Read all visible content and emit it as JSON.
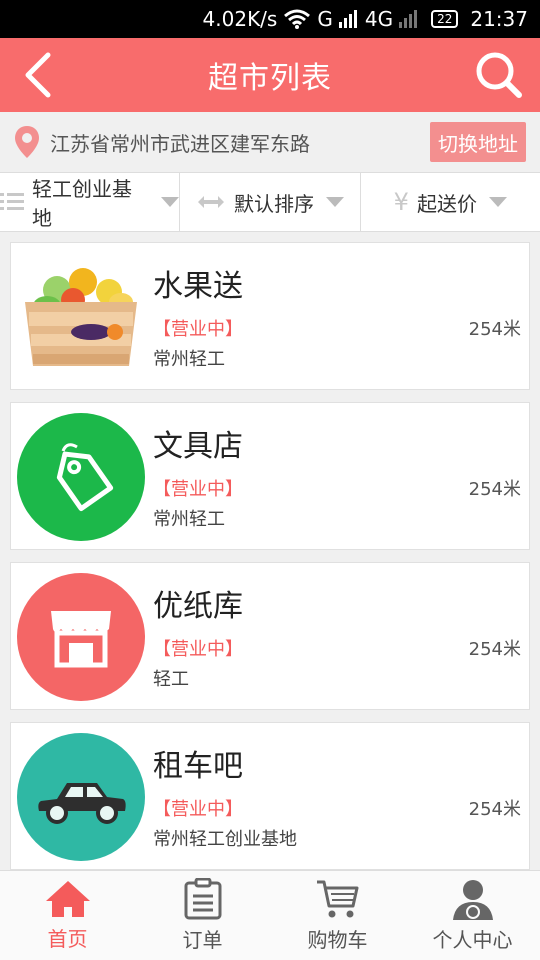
{
  "status_bar": {
    "speed": "4.02K/s",
    "network_g": "G",
    "network_4g": "4G",
    "battery": "22",
    "time": "21:37"
  },
  "header": {
    "title": "超市列表"
  },
  "location": {
    "address": "江苏省常州市武进区建军东路",
    "switch_label": "切换地址"
  },
  "filters": [
    {
      "label": "轻工创业基地",
      "icon": "list-icon"
    },
    {
      "label": "默认排序",
      "icon": "swap-arrows-icon"
    },
    {
      "label": "起送价",
      "icon": "yen-icon"
    }
  ],
  "stores": [
    {
      "name": "水果送",
      "status": "【营业中】",
      "area": "常州轻工",
      "distance": "254米",
      "icon": "fruit-crate-icon"
    },
    {
      "name": "文具店",
      "status": "【营业中】",
      "area": "常州轻工",
      "distance": "254米",
      "icon": "tag-icon",
      "color": "#1cb84a"
    },
    {
      "name": "优纸库",
      "status": "【营业中】",
      "area": "轻工",
      "distance": "254米",
      "icon": "storefront-icon",
      "color": "#f46666"
    },
    {
      "name": "租车吧",
      "status": "【营业中】",
      "area": "常州轻工创业基地",
      "distance": "254米",
      "icon": "car-icon",
      "color": "#2fb8a4"
    }
  ],
  "tabs": [
    {
      "label": "首页",
      "icon": "home-icon",
      "active": true
    },
    {
      "label": "订单",
      "icon": "clipboard-icon",
      "active": false
    },
    {
      "label": "购物车",
      "icon": "cart-icon",
      "active": false
    },
    {
      "label": "个人中心",
      "icon": "user-icon",
      "active": false
    }
  ],
  "colors": {
    "accent": "#f86c6c",
    "status_red": "#f45b5b",
    "switch_button": "#f38f8f"
  }
}
